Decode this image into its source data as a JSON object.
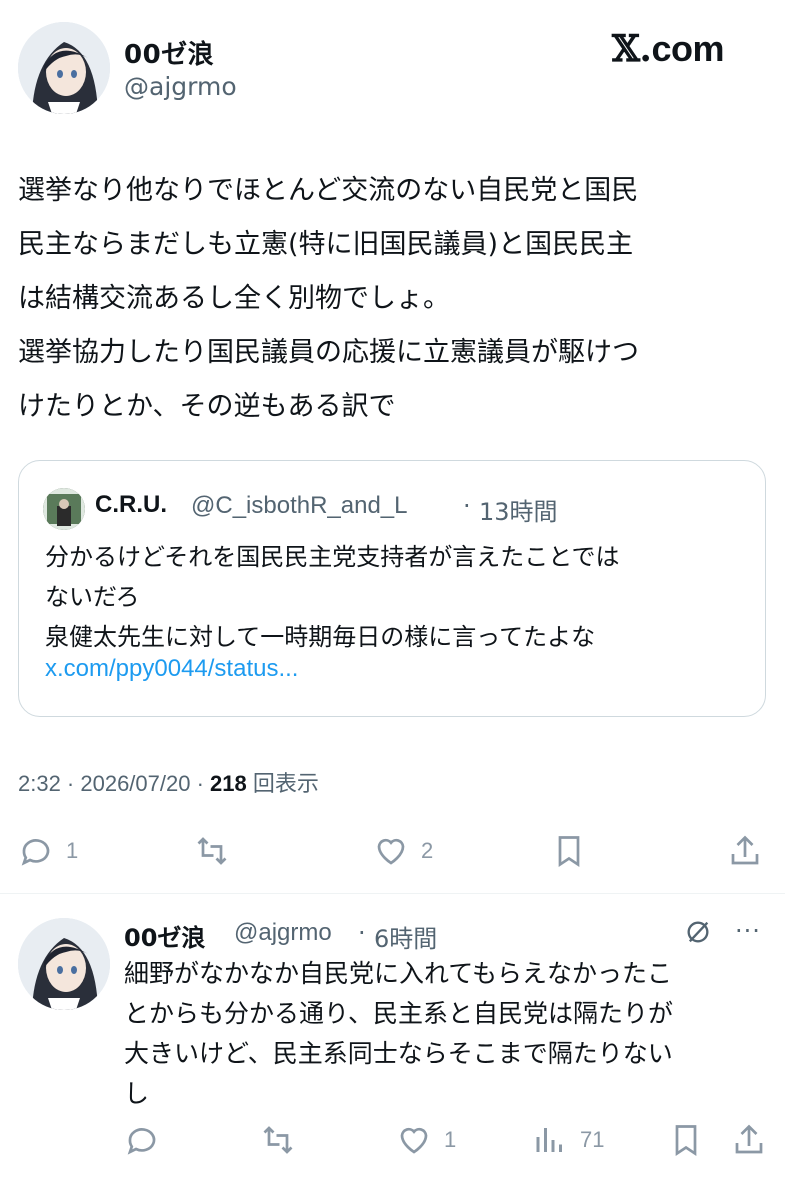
{
  "header": {
    "author_name": "00ゼ浪",
    "author_handle": "@ajgrmo",
    "site_logo": "com",
    "site_logo_x": "𝕏."
  },
  "tweet": {
    "text": "選挙なり他なりでほとんど交流のない自民党と国民\n民主ならまだしも立憲(特に旧国民議員)と国民民主\nは結構交流あるし全く別物でしょ。\n選挙協力したり国民議員の応援に立憲議員が駆けつ\nけたりとか、その逆もある訳で",
    "time": "2:32 · 2026/07/20 · ",
    "views_count": "218",
    "views_label": " 回表示"
  },
  "quote": {
    "name": "C.R.U.",
    "handle": "@C_isbothR_and_L",
    "dot": "·",
    "time": "13時間",
    "text": "分かるけどそれを国民民主党支持者が言えたことでは\nないだろ\n泉健太先生に対して一時期毎日の様に言ってたよな",
    "link": "x.com/ppy0044/status..."
  },
  "actions": {
    "reply_count": "1",
    "retweet_count": "",
    "like_count": "2"
  },
  "reply": {
    "name": "00ゼ浪",
    "handle": "@ajgrmo",
    "dot": "·",
    "time": "6時間",
    "more": "···",
    "text": "細野がなかなか自民党に入れてもらえなかったこ\nとからも分かる通り、民主系と自民党は隔たりが\n大きいけど、民主系同士ならそこまで隔たりない\nし",
    "reply_count": "",
    "retweet_count": "",
    "like_count": "1",
    "views_count": "71"
  },
  "colors": {
    "text": "#0f1419",
    "secondary": "#536471",
    "link": "#1d9bf0",
    "border": "#cfd9de",
    "icon": "#8b98a5"
  }
}
